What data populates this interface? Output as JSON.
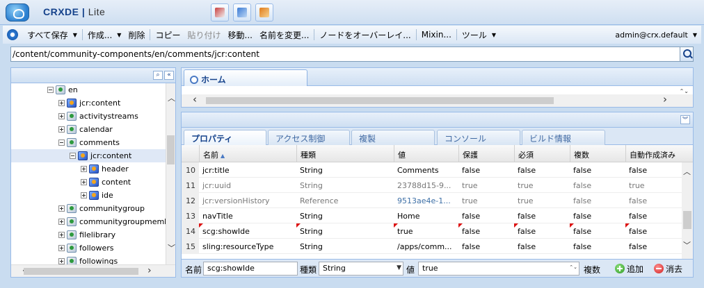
{
  "app": {
    "title_main": "CRXDE",
    "title_sub": "Lite"
  },
  "toolbar_icons": [
    "tools-icon",
    "package-icon",
    "bundle-icon"
  ],
  "menubar": {
    "items": [
      {
        "label": "すべて保存",
        "dropdown": true,
        "disabled": false
      },
      {
        "label": "作成...",
        "dropdown": true,
        "disabled": false
      },
      {
        "label": "削除",
        "dropdown": false,
        "disabled": false
      },
      {
        "label": "コピー",
        "dropdown": false,
        "disabled": false
      },
      {
        "label": "貼り付け",
        "dropdown": false,
        "disabled": true
      },
      {
        "label": "移動...",
        "dropdown": false,
        "disabled": false
      },
      {
        "label": "名前を変更...",
        "dropdown": false,
        "disabled": false
      },
      {
        "label": "ノードをオーバーレイ...",
        "dropdown": false,
        "disabled": false
      },
      {
        "label": "Mixin...",
        "dropdown": false,
        "disabled": false
      },
      {
        "label": "ツール",
        "dropdown": true,
        "disabled": false
      }
    ],
    "user": "admin@crx.default"
  },
  "path": {
    "value": "/content/community-components/en/comments/jcr:content"
  },
  "tree": {
    "nodes": [
      {
        "label": "en",
        "expanded": true,
        "jcr": false
      },
      {
        "label": "jcr:content",
        "expanded": false,
        "jcr": true
      },
      {
        "label": "activitystreams",
        "expanded": false,
        "jcr": false
      },
      {
        "label": "calendar",
        "expanded": false,
        "jcr": false
      },
      {
        "label": "comments",
        "expanded": true,
        "jcr": false
      },
      {
        "label": "jcr:content",
        "expanded": true,
        "jcr": true,
        "selected": true
      },
      {
        "label": "header",
        "expanded": false,
        "jcr": true
      },
      {
        "label": "content",
        "expanded": false,
        "jcr": true
      },
      {
        "label": "ide",
        "expanded": false,
        "jcr": true
      },
      {
        "label": "communitygroup",
        "expanded": false,
        "jcr": false
      },
      {
        "label": "communitygroupmemberlis",
        "expanded": false,
        "jcr": false
      },
      {
        "label": "filelibrary",
        "expanded": false,
        "jcr": false
      },
      {
        "label": "followers",
        "expanded": false,
        "jcr": false
      },
      {
        "label": "followings",
        "expanded": false,
        "jcr": false
      }
    ]
  },
  "home_tab": {
    "label": "ホーム"
  },
  "props_tabs": [
    "プロパティ",
    "アクセス制御",
    "複製",
    "コンソール",
    "ビルド情報"
  ],
  "grid": {
    "columns": [
      "名前",
      "種類",
      "値",
      "保護",
      "必須",
      "複数",
      "自動作成済み"
    ],
    "rows": [
      {
        "num": "10",
        "name": "jcr:title",
        "type": "String",
        "value": "Comments",
        "protected": "false",
        "mandatory": "false",
        "multiple": "false",
        "autocreated": "false",
        "style": "normal"
      },
      {
        "num": "11",
        "name": "jcr:uuid",
        "type": "String",
        "value": "23788d15-9...",
        "protected": "true",
        "mandatory": "true",
        "multiple": "false",
        "autocreated": "true",
        "style": "protected"
      },
      {
        "num": "12",
        "name": "jcr:versionHistory",
        "type": "Reference",
        "value": "9513ae4e-1...",
        "protected": "true",
        "mandatory": "true",
        "multiple": "false",
        "autocreated": "false",
        "style": "protected-link"
      },
      {
        "num": "13",
        "name": "navTitle",
        "type": "String",
        "value": "Home",
        "protected": "false",
        "mandatory": "false",
        "multiple": "false",
        "autocreated": "false",
        "style": "normal"
      },
      {
        "num": "14",
        "name": "scg:showIde",
        "type": "String",
        "value": "true",
        "protected": "false",
        "mandatory": "false",
        "multiple": "false",
        "autocreated": "false",
        "style": "dirty"
      },
      {
        "num": "15",
        "name": "sling:resourceType",
        "type": "String",
        "value": "/apps/comm...",
        "protected": "false",
        "mandatory": "false",
        "multiple": "false",
        "autocreated": "false",
        "style": "normal"
      }
    ]
  },
  "edit": {
    "name_label": "名前",
    "name_value": "scg:showIde",
    "type_label": "種類",
    "type_value": "String",
    "value_label": "値",
    "value_value": "true",
    "multi_label": "複数",
    "add_label": "追加",
    "remove_label": "消去"
  }
}
